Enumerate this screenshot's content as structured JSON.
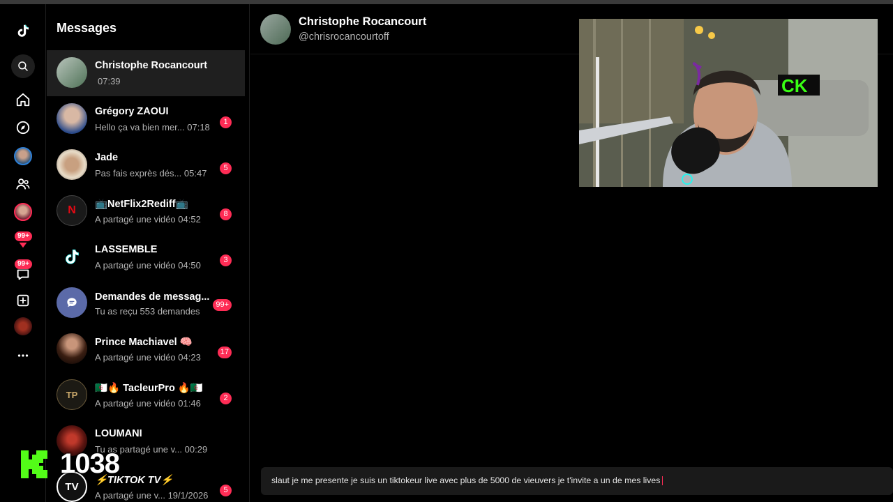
{
  "rail": {
    "badge_activity": "99+",
    "badge_messages": "99+"
  },
  "list": {
    "title": "Messages",
    "conversations": [
      {
        "name": "Christophe Rocancourt",
        "preview": "",
        "time": "07:39",
        "badge": "",
        "initial": ""
      },
      {
        "name": "Grégory ZAOUI",
        "preview": "Hello ça va bien mer...",
        "time": "07:18",
        "badge": "1",
        "initial": ""
      },
      {
        "name": "Jade",
        "preview": "Pas fais exprès dés...",
        "time": "05:47",
        "badge": "5",
        "initial": ""
      },
      {
        "name": "📺NetFlix2Rediff📺",
        "preview": "A partagé une vidéo",
        "time": "04:52",
        "badge": "8",
        "initial": "N"
      },
      {
        "name": "LASSEMBLE",
        "preview": "A partagé une vidéo",
        "time": "04:50",
        "badge": "3",
        "initial": ""
      },
      {
        "name": "Demandes de messag...",
        "preview": "Tu as reçu 553 demandes",
        "time": "",
        "badge": "99+",
        "initial": ""
      },
      {
        "name": "Prince Machiavel 🧠",
        "preview": "A partagé une vidéo",
        "time": "04:23",
        "badge": "17",
        "initial": ""
      },
      {
        "name": "🇩🇿🔥 TacleurPro 🔥🇩🇿",
        "preview": "A partagé une vidéo",
        "time": "01:46",
        "badge": "2",
        "initial": "TP"
      },
      {
        "name": "LOUMANI",
        "preview": "Tu as partagé une v...",
        "time": "00:29",
        "badge": "",
        "initial": ""
      },
      {
        "name": "⚡TIKTOK TV⚡",
        "preview": "A partagé une v...",
        "time": "19/1/2026",
        "badge": "5",
        "initial": "TV"
      }
    ]
  },
  "chat": {
    "name": "Christophe Rocancourt",
    "handle": "@chrisrocancourtoff"
  },
  "composer": {
    "text": "slaut je me presente je suis un tiktokeur live avec plus de 5000 de vieuvers je t'invite a un de mes lives"
  },
  "overlay": {
    "count": "1038"
  },
  "colors": {
    "accent": "#fe2c55",
    "background": "#000000",
    "active_row": "#1f1f1f"
  }
}
